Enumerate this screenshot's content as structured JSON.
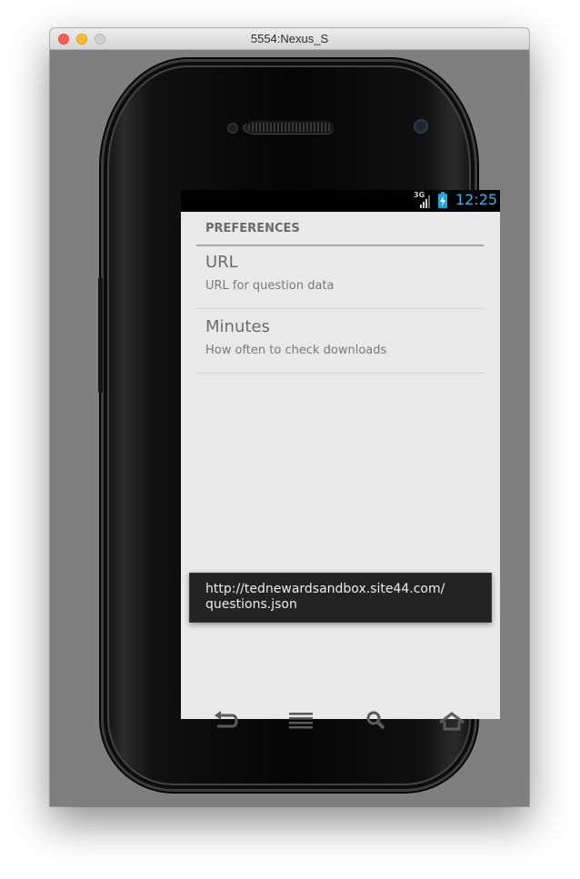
{
  "window": {
    "title": "5554:Nexus_S"
  },
  "status_bar": {
    "network": "3G",
    "time": "12:25",
    "accent_color": "#33b5e5"
  },
  "preferences": {
    "category": "PREFERENCES",
    "items": [
      {
        "title": "URL",
        "summary": "URL for question data"
      },
      {
        "title": "Minutes",
        "summary": "How often to check downloads"
      }
    ]
  },
  "toast": {
    "line1": "http://tednewardsandbox.site44.com/",
    "line2": "questions.json"
  },
  "nav_keys": [
    "back-icon",
    "menu-icon",
    "search-icon",
    "home-icon"
  ]
}
